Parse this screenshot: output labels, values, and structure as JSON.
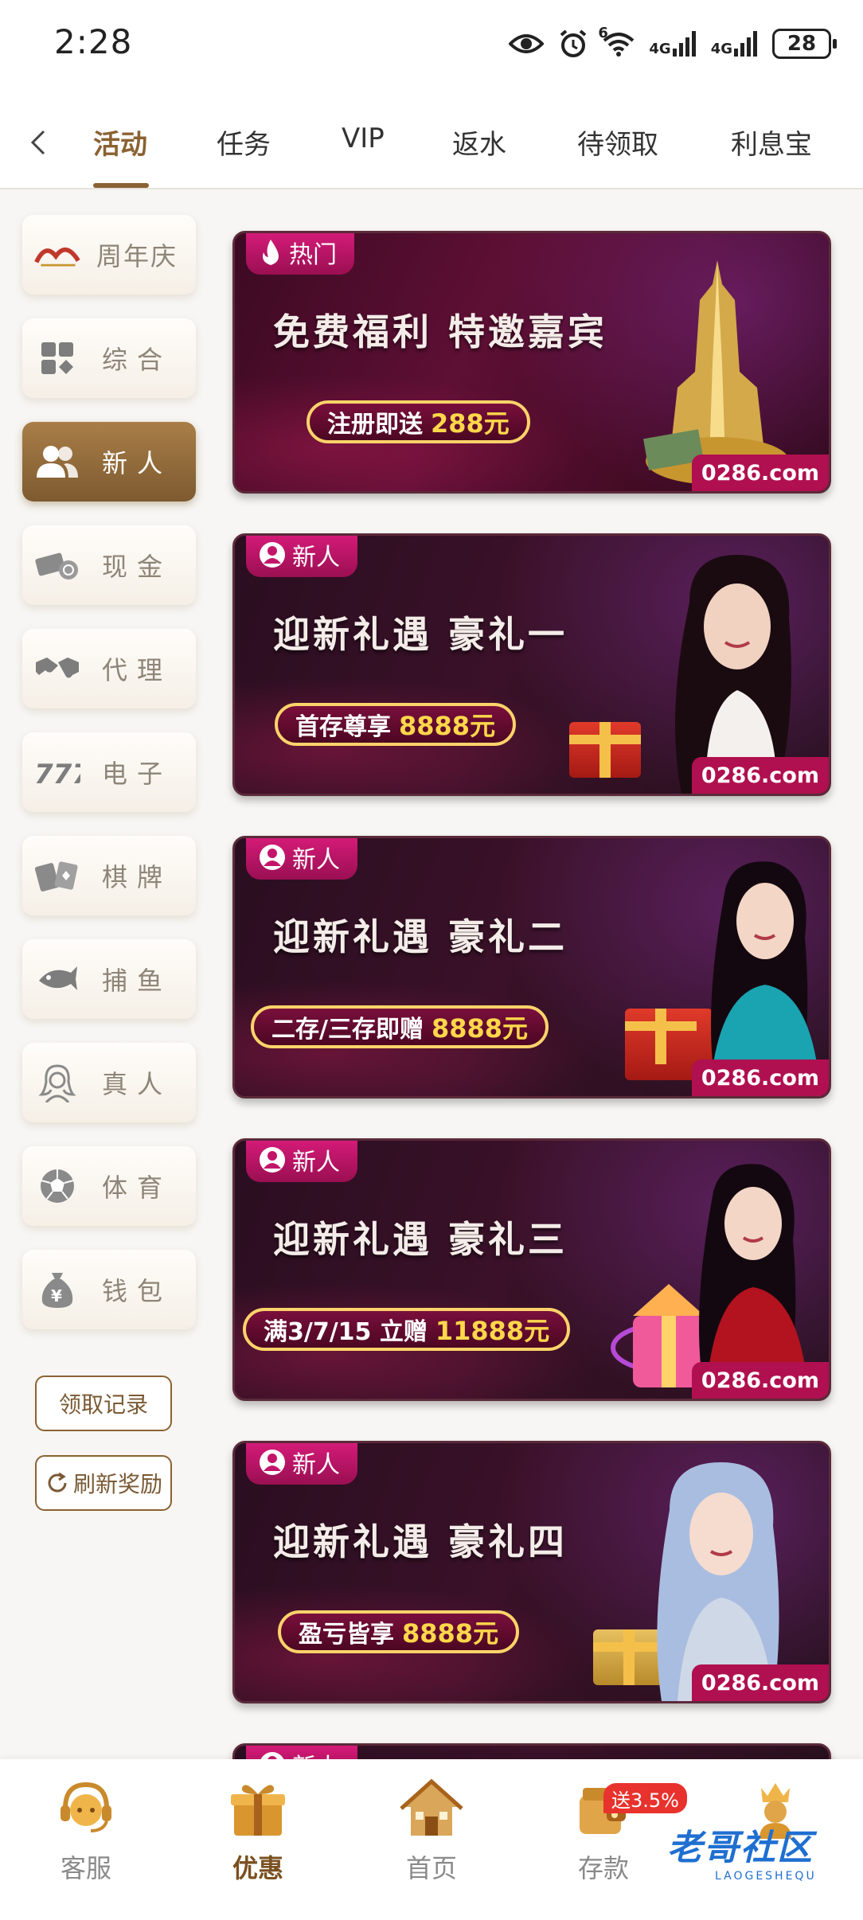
{
  "status_bar": {
    "time": "2:28",
    "network_1": "4G",
    "network_2": "4G",
    "wifi_label": "6",
    "battery": "28",
    "icons": [
      "eye-icon",
      "alarm-icon",
      "wifi-icon",
      "signal-icon",
      "signal-icon",
      "battery-icon"
    ]
  },
  "top_nav": {
    "tabs": [
      {
        "label": "活动",
        "active": true
      },
      {
        "label": "任务"
      },
      {
        "label": "VIP"
      },
      {
        "label": "返水"
      },
      {
        "label": "待领取"
      },
      {
        "label": "利息宝"
      }
    ]
  },
  "sidebar": {
    "items": [
      {
        "label": "周年庆",
        "icon": "anniversary-logo"
      },
      {
        "label": "综合",
        "icon": "grid-icon"
      },
      {
        "label": "新人",
        "icon": "users-icon",
        "active": true
      },
      {
        "label": "现金",
        "icon": "cash-icon"
      },
      {
        "label": "代理",
        "icon": "handshake-icon"
      },
      {
        "label": "电子",
        "icon": "slot-777-icon"
      },
      {
        "label": "棋牌",
        "icon": "cards-icon"
      },
      {
        "label": "捕鱼",
        "icon": "fish-icon"
      },
      {
        "label": "真人",
        "icon": "live-dealer-icon"
      },
      {
        "label": "体育",
        "icon": "soccer-ball-icon"
      },
      {
        "label": "钱包",
        "icon": "money-bag-icon"
      }
    ],
    "records_button": "领取记录",
    "refresh_button": "刷新奖励"
  },
  "banners": [
    {
      "badge": "热门",
      "badge_icon": "flame-icon",
      "title": "免费福利  特邀嘉宾",
      "pill_text": "注册即送",
      "pill_amount": "288元",
      "site": "0286.com"
    },
    {
      "badge": "新人",
      "badge_icon": "user-icon",
      "title": "迎新礼遇 豪礼一",
      "pill_text": "首存尊享",
      "pill_amount": "8888元",
      "site": "0286.com"
    },
    {
      "badge": "新人",
      "badge_icon": "user-icon",
      "title": "迎新礼遇 豪礼二",
      "pill_text": "二存/三存即赠",
      "pill_amount": "8888元",
      "site": "0286.com"
    },
    {
      "badge": "新人",
      "badge_icon": "user-icon",
      "title": "迎新礼遇 豪礼三",
      "pill_text": "满3/7/15 立赠",
      "pill_amount": "11888元",
      "site": "0286.com"
    },
    {
      "badge": "新人",
      "badge_icon": "user-icon",
      "title": "迎新礼遇 豪礼四",
      "pill_text": "盈亏皆享",
      "pill_amount": "8888元",
      "site": "0286.com"
    },
    {
      "badge": "新人",
      "badge_icon": "user-icon"
    }
  ],
  "bottom_nav": {
    "items": [
      {
        "label": "客服",
        "icon": "customer-service-icon"
      },
      {
        "label": "优惠",
        "icon": "gift-box-icon",
        "active": true
      },
      {
        "label": "首页",
        "icon": "home-icon"
      },
      {
        "label": "存款",
        "icon": "wallet-icon"
      },
      {
        "label": "",
        "icon": "crown-trophy-icon"
      }
    ],
    "deposit_badge": "送3.5%"
  },
  "watermark": {
    "text": "老哥社区",
    "sub": "LAOGESHEQU"
  },
  "colors": {
    "accent": "#8a6232",
    "banner_badge": "#c2156a",
    "pill_amount": "#ffd74a"
  }
}
